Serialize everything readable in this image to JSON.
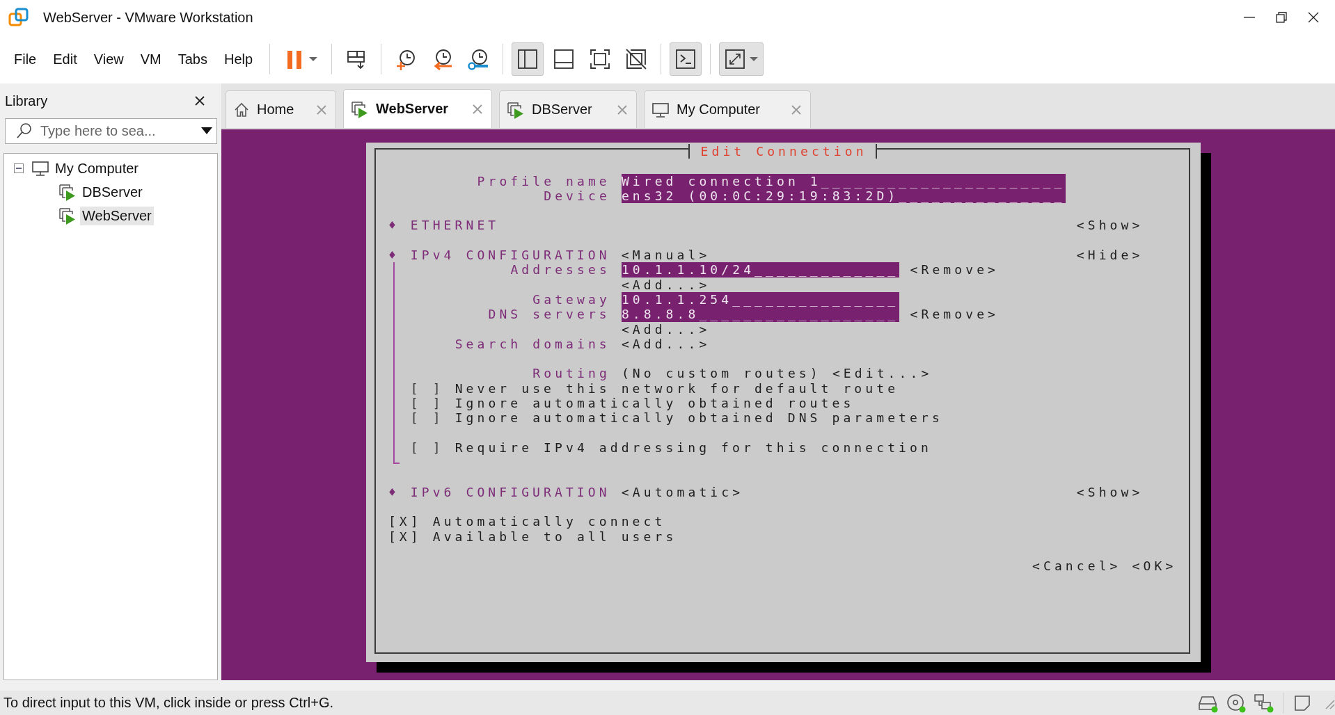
{
  "window": {
    "title": "WebServer - VMware Workstation"
  },
  "menu": [
    "File",
    "Edit",
    "View",
    "VM",
    "Tabs",
    "Help"
  ],
  "toolbar": [
    [
      {
        "kind": "pause",
        "pressed": false
      }
    ],
    [
      {
        "kind": "send-keys",
        "pressed": false
      }
    ],
    [
      {
        "kind": "snapshot-take",
        "pressed": false
      },
      {
        "kind": "snapshot-revert",
        "pressed": false
      },
      {
        "kind": "snapshot-manage",
        "pressed": false
      }
    ],
    [
      {
        "kind": "library",
        "pressed": true
      },
      {
        "kind": "thumbnails",
        "pressed": false
      },
      {
        "kind": "fullscreen",
        "pressed": false
      },
      {
        "kind": "unity",
        "pressed": false
      }
    ],
    [
      {
        "kind": "console",
        "pressed": true
      }
    ],
    [
      {
        "kind": "stretch",
        "pressed": true
      }
    ]
  ],
  "sidebar": {
    "title": "Library",
    "search": {
      "placeholder": "Type here to sea..."
    },
    "tree": [
      {
        "label": "My Computer",
        "kind": "computer",
        "expanded": true,
        "selected": false,
        "children": [
          {
            "label": "DBServer",
            "kind": "vm",
            "selected": false
          },
          {
            "label": "WebServer",
            "kind": "vm",
            "selected": true
          }
        ]
      }
    ]
  },
  "tabs": [
    {
      "label": "Home",
      "kind": "home",
      "selected": false
    },
    {
      "label": "WebServer",
      "kind": "vm",
      "selected": true
    },
    {
      "label": "DBServer",
      "kind": "vm",
      "selected": false
    },
    {
      "label": "My Computer",
      "kind": "computer",
      "selected": false
    }
  ],
  "dialog": {
    "title": "Edit Connection",
    "fields": [
      {
        "label": "Profile name",
        "value": "Wired connection 1______________________"
      },
      {
        "label": "Device",
        "value": "ens32 (00:0C:29:19:83:2D)_______________"
      }
    ],
    "sections": [
      {
        "bullet": "♦",
        "title": "ETHERNET",
        "toggle": "<Show>"
      },
      {
        "bullet": "♦",
        "title": "IPv4 CONFIGURATION",
        "mode": "<Manual>",
        "toggle": "<Hide>",
        "expanded": true,
        "rows": [
          {
            "kind": "field",
            "label": "Addresses",
            "value": "10.1.1.10/24_____________",
            "action": "<Remove>"
          },
          {
            "kind": "add",
            "text": "<Add...>"
          },
          {
            "kind": "field",
            "label": "Gateway",
            "value": "10.1.1.254_______________"
          },
          {
            "kind": "field",
            "label": "DNS servers",
            "value": "8.8.8.8__________________",
            "action": "<Remove>"
          },
          {
            "kind": "add",
            "text": "<Add...>"
          },
          {
            "kind": "add",
            "label": "Search domains",
            "text": "<Add...>"
          },
          {
            "kind": "routing",
            "label": "Routing",
            "value": "(No custom routes)",
            "action": "<Edit...>"
          }
        ],
        "checkbox_groups": [
          [
            {
              "box": "[ ]",
              "checked": false,
              "label": "Never use this network for default route"
            },
            {
              "box": "[ ]",
              "checked": false,
              "label": "Ignore automatically obtained routes"
            },
            {
              "box": "[ ]",
              "checked": false,
              "label": "Ignore automatically obtained DNS parameters"
            }
          ],
          [
            {
              "box": "[ ]",
              "checked": false,
              "label": "Require IPv4 addressing for this connection"
            }
          ]
        ]
      },
      {
        "bullet": "♦",
        "title": "IPv6 CONFIGURATION",
        "mode": "<Automatic>",
        "toggle": "<Show>"
      }
    ],
    "options": [
      {
        "box": "[X]",
        "checked": true,
        "label": "Automatically connect"
      },
      {
        "box": "[X]",
        "checked": true,
        "label": "Available to all users"
      }
    ],
    "buttons": [
      "<Cancel>",
      "<OK>"
    ]
  },
  "status_bar": {
    "text": "To direct input to this VM, click inside or press Ctrl+G.",
    "devices": [
      {
        "kind": "hdd",
        "active": true
      },
      {
        "kind": "cd",
        "active": true
      },
      {
        "kind": "network",
        "active": true
      }
    ]
  }
}
